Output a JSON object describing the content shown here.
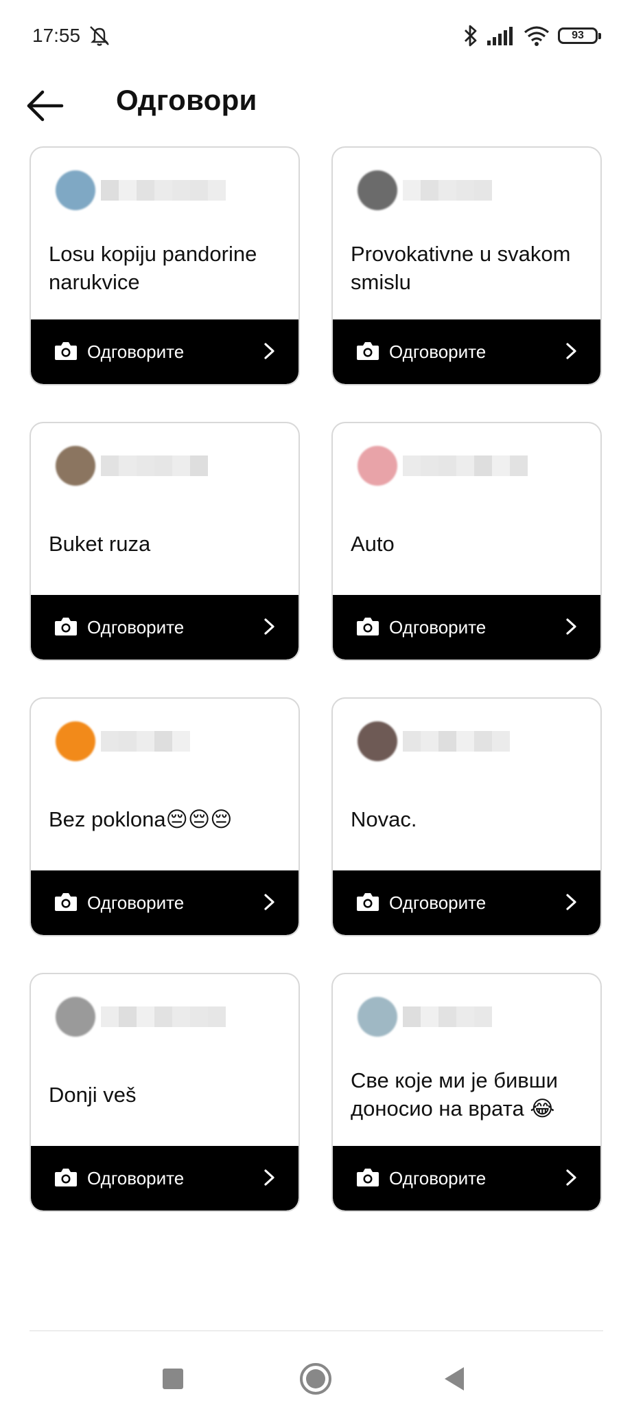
{
  "status_bar": {
    "time": "17:55",
    "battery": "93",
    "icons": [
      "mute-icon",
      "bluetooth-icon",
      "signal-icon",
      "wifi-icon",
      "battery-icon"
    ]
  },
  "header": {
    "title": "Одговори",
    "back_icon": "arrow-left-icon"
  },
  "action_label": "Одговорите",
  "cards": [
    {
      "text": "",
      "avatar_color": "#cccccc"
    },
    {
      "text": "",
      "avatar_color": "#cccccc"
    },
    {
      "text": "Losu kopiju pandorine narukvice",
      "avatar_color": "#7fa8c4"
    },
    {
      "text": "Provokativne u svakom smislu",
      "avatar_color": "#6b6b6b"
    },
    {
      "text": "Buket ruza",
      "avatar_color": "#8b7560"
    },
    {
      "text": "Auto",
      "avatar_color": "#e8a3a8"
    },
    {
      "text": "Bez poklona😔😔😔",
      "avatar_color": "#f28a1a"
    },
    {
      "text": "Novac.",
      "avatar_color": "#6e5a55"
    },
    {
      "text": "Donji veš",
      "avatar_color": "#9a9a9a"
    },
    {
      "text": "Све које ми је бивши доносио на врата 😂",
      "avatar_color": "#9fb8c4"
    }
  ],
  "colors": {
    "action_bar": "#000000",
    "card_border": "#d8d8d8",
    "nav_gray": "#888888"
  }
}
